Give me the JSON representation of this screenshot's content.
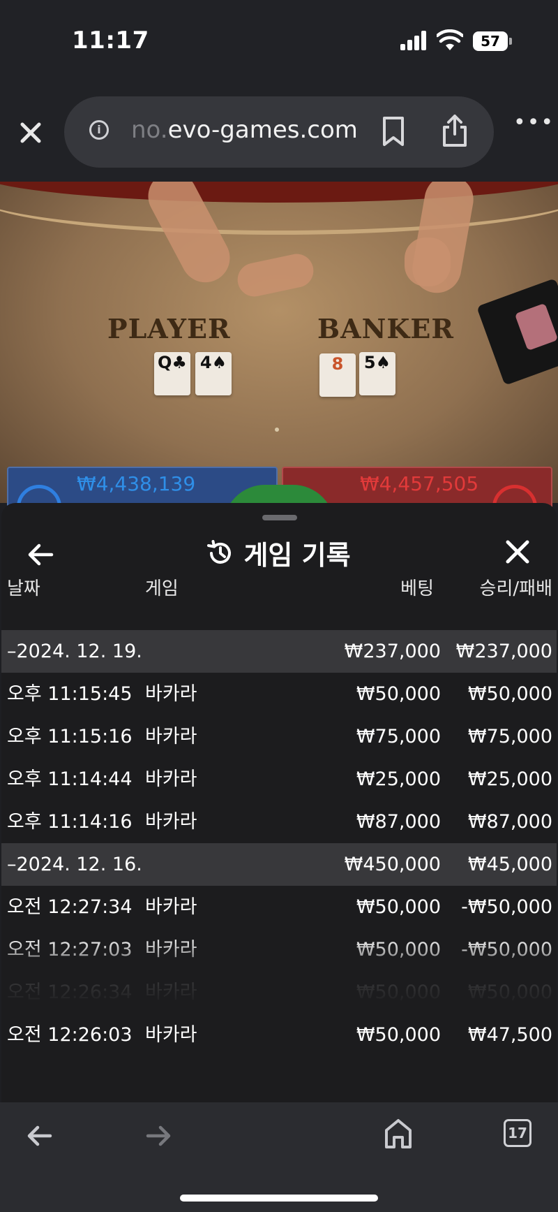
{
  "status_bar": {
    "time": "11:17",
    "battery": "57"
  },
  "browser": {
    "url_faded": "no.",
    "url_main": "evo-games.com",
    "tab_count": "17"
  },
  "video": {
    "player_label": "PLAYER",
    "banker_label": "BANKER",
    "player_cards": [
      "Q♣",
      "4♠"
    ],
    "banker_cards": [
      "8",
      "5♠"
    ],
    "player_total": "₩4,438,139",
    "banker_total": "₩4,457,505"
  },
  "panel": {
    "title": "게임 기록",
    "columns": {
      "date": "날짜",
      "game": "게임",
      "bet": "베팅",
      "winloss": "승리/패배"
    },
    "groups": [
      {
        "date": "–2024. 12. 19.",
        "bet": "₩237,000",
        "winloss": "₩237,000",
        "rows": [
          {
            "time": "오후 11:15:45",
            "game": "바카라",
            "bet": "₩50,000",
            "winloss": "₩50,000"
          },
          {
            "time": "오후 11:15:16",
            "game": "바카라",
            "bet": "₩75,000",
            "winloss": "₩75,000"
          },
          {
            "time": "오후 11:14:44",
            "game": "바카라",
            "bet": "₩25,000",
            "winloss": "₩25,000"
          },
          {
            "time": "오후 11:14:16",
            "game": "바카라",
            "bet": "₩87,000",
            "winloss": "₩87,000"
          }
        ]
      },
      {
        "date": "–2024. 12. 16.",
        "bet": "₩450,000",
        "winloss": "₩45,000",
        "rows": [
          {
            "time": "오전 12:27:34",
            "game": "바카라",
            "bet": "₩50,000",
            "winloss": "-₩50,000"
          },
          {
            "time": "오전 12:27:03",
            "game": "바카라",
            "bet": "₩50,000",
            "winloss": "-₩50,000"
          },
          {
            "time": "오전 12:26:34",
            "game": "바카라",
            "bet": "₩50,000",
            "winloss": "₩50,000"
          },
          {
            "time": "오전 12:26:03",
            "game": "바카라",
            "bet": "₩50,000",
            "winloss": "₩47,500"
          }
        ]
      }
    ]
  },
  "icons": {
    "close": "close-icon",
    "info": "info-icon",
    "bookmark": "bookmark-icon",
    "share": "share-icon",
    "more": "more-icon",
    "back": "back-arrow-icon",
    "history": "history-icon",
    "home": "home-icon",
    "tabs": "tabs-icon"
  }
}
